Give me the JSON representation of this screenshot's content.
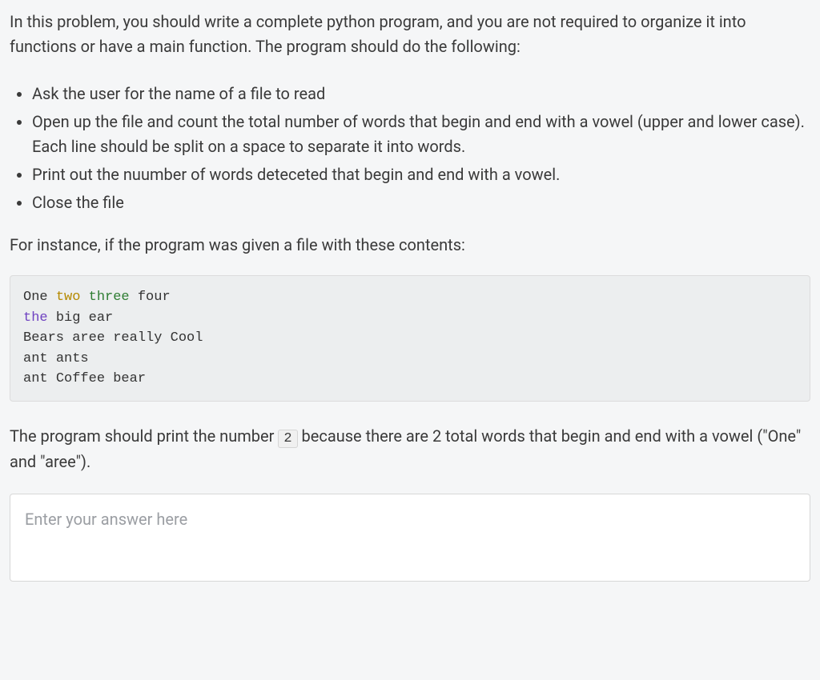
{
  "intro": "In this problem, you should write a complete python program, and you are not required to organize it into functions or have a main function. The program should do the following:",
  "bullets": [
    "Ask the user for the name of a file to read",
    "Open up the file and count the total number of words that begin and end with a vowel (upper and lower case).",
    "Each line should be split on a space to separate it into words.",
    "Print out the nuumber of words deteceted that begin and end with a vowel.",
    "Close the file"
  ],
  "between": "For instance, if the program was given a file with these contents:",
  "code_lines": [
    [
      "One",
      "two",
      "three",
      "four"
    ],
    [
      "the",
      "big",
      "ear"
    ],
    [
      "Bears",
      "aree",
      "really",
      "Cool"
    ],
    [
      "ant",
      "ants"
    ],
    [
      "ant",
      "Coffee",
      "bear"
    ]
  ],
  "result_before": "The program should print the number ",
  "result_code": "2",
  "result_after": " because there are 2 total words that begin and end with a vowel (\"One\" and \"aree\").",
  "answer_placeholder": "Enter your answer here",
  "chart_data": {
    "type": "table",
    "title": "Sample file contents",
    "rows": [
      "One two three four",
      "the big ear",
      "Bears aree really Cool",
      "ant ants",
      "ant Coffee bear"
    ],
    "expected_output": 2,
    "matching_words": [
      "One",
      "aree"
    ]
  }
}
